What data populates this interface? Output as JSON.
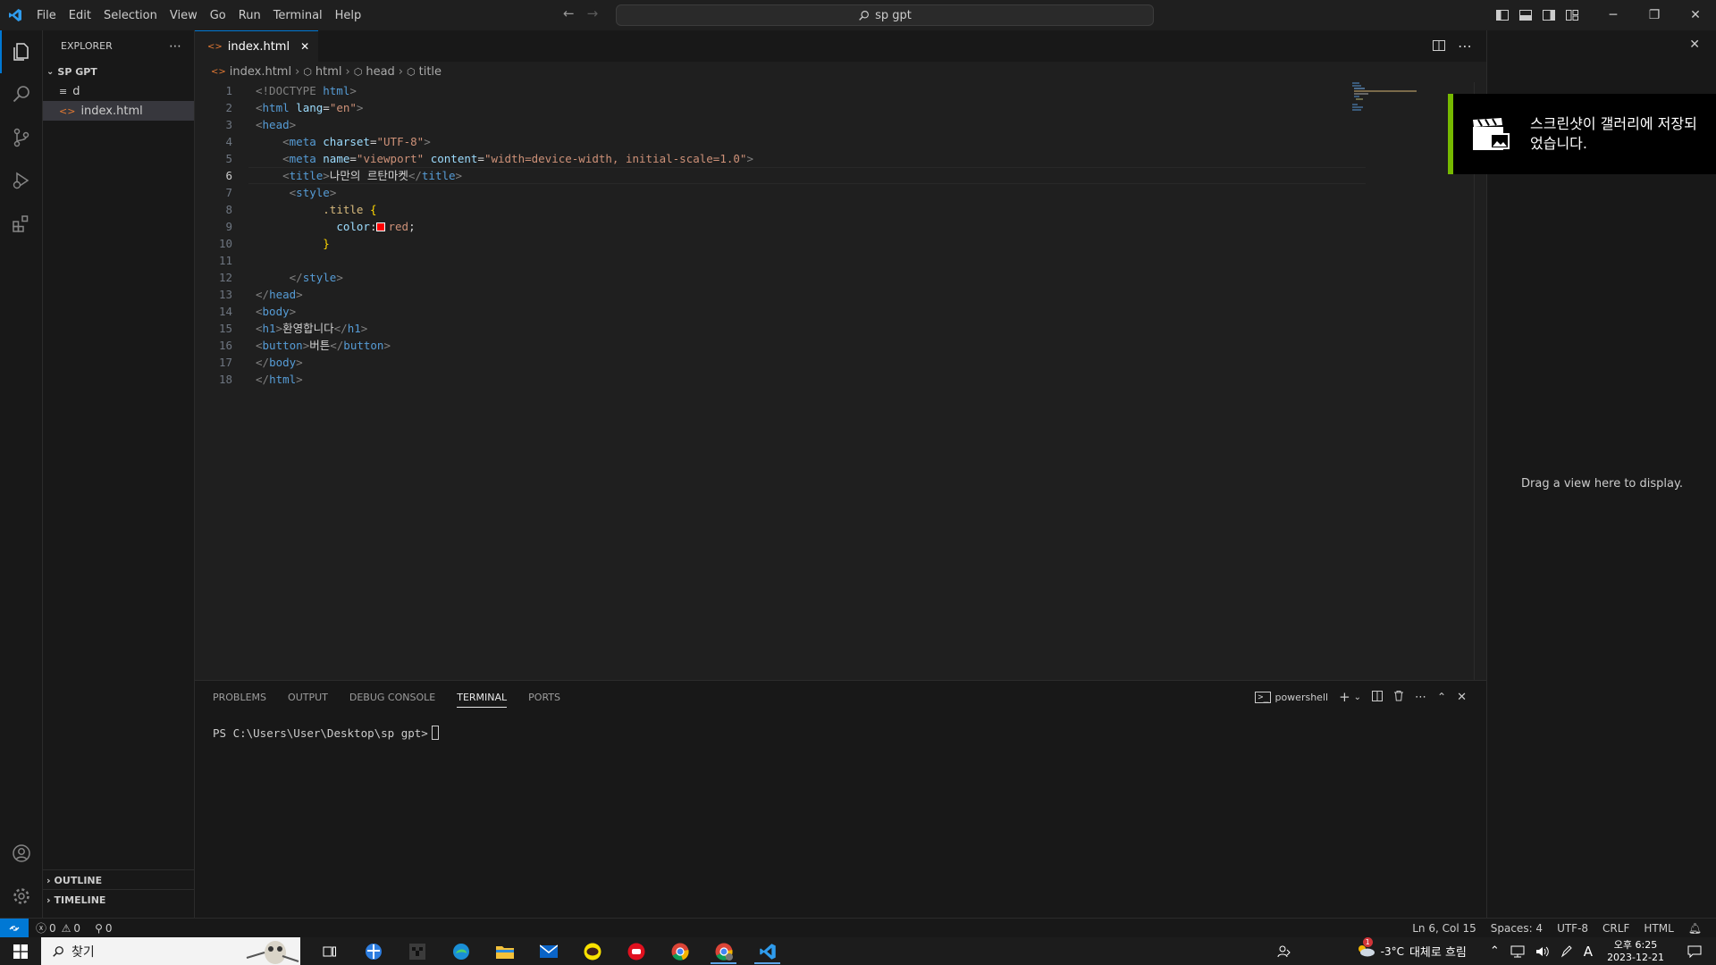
{
  "menu": [
    "File",
    "Edit",
    "Selection",
    "View",
    "Go",
    "Run",
    "Terminal",
    "Help"
  ],
  "command_center": {
    "text": "sp gpt"
  },
  "sidebar": {
    "title": "EXPLORER",
    "folder": "SP GPT",
    "items": [
      {
        "name": "d"
      },
      {
        "name": "index.html"
      }
    ],
    "outline": "OUTLINE",
    "timeline": "TIMELINE"
  },
  "editor": {
    "tab": "index.html",
    "breadcrumb": [
      "index.html",
      "html",
      "head",
      "title"
    ]
  },
  "code": {
    "l1_doctype": "<!DOCTYPE",
    "l1_html": " html",
    "l2_tag": "html",
    "l2_attr": " lang",
    "l2_val": "\"en\"",
    "l3_tag": "head",
    "l4_tag": "meta",
    "l4_attr": " charset",
    "l4_val": "\"UTF-8\"",
    "l5_tag": "meta",
    "l5_attr1": " name",
    "l5_val1": "\"viewport\"",
    "l5_attr2": " content",
    "l5_val2": "\"width=device-width, initial-scale=1.0\"",
    "l6_tag": "title",
    "l6_text": "나만의 르탄마켓",
    "l6_end": "title",
    "l7_tag": "style",
    "l8_sel": ".title",
    "l9_prop": "color",
    "l9_val": "red",
    "l12_tag": "style",
    "l13_tag": "head",
    "l14_tag": "body",
    "l15_tag": "h1",
    "l15_text": "환영합니다",
    "l15_end": "h1",
    "l16_tag": "button",
    "l16_text": "버튼",
    "l16_end": "button",
    "l17_tag": "body",
    "l18_tag": "html"
  },
  "line_numbers": [
    "1",
    "2",
    "3",
    "4",
    "5",
    "6",
    "7",
    "8",
    "9",
    "10",
    "11",
    "12",
    "13",
    "14",
    "15",
    "16",
    "17",
    "18"
  ],
  "panel": {
    "tabs": [
      "PROBLEMS",
      "OUTPUT",
      "DEBUG CONSOLE",
      "TERMINAL",
      "PORTS"
    ],
    "shell": "powershell",
    "prompt": "PS C:\\Users\\User\\Desktop\\sp gpt>"
  },
  "aux": {
    "message": "Drag a view here to display."
  },
  "toast": {
    "text": "스크린샷이 갤러리에 저장되었습니다."
  },
  "status": {
    "errors": "0",
    "warnings": "0",
    "ports": "0",
    "position": "Ln 6, Col 15",
    "spaces": "Spaces: 4",
    "encoding": "UTF-8",
    "eol": "CRLF",
    "language": "HTML"
  },
  "taskbar": {
    "search": "찾기",
    "weather_temp": "-3°C",
    "weather_text": "대체로 흐림",
    "weather_badge": "1",
    "ime": "A",
    "time": "오후 6:25",
    "date": "2023-12-21"
  },
  "colors": {
    "accent": "#0078d4",
    "toast_bar": "#76b900"
  }
}
